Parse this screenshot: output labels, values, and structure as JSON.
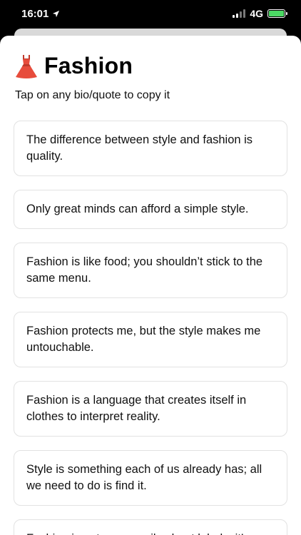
{
  "status_bar": {
    "time": "16:01",
    "network": "4G",
    "battery_color": "#4cd964"
  },
  "header": {
    "icon": "dress-icon",
    "title": "Fashion",
    "subtitle": "Tap on any bio/quote to copy it"
  },
  "quotes": [
    "The difference between style and fashion is quality.",
    "Only great minds can afford a simple style.",
    "Fashion is like food; you shouldn’t stick to the same menu.",
    "Fashion protects me, but the style makes me untouchable.",
    "Fashion is a language that creates itself in clothes to interpret reality.",
    "Style is something each of us already has; all we need to do is find it.",
    "Fashion is not necessarily about labels; it’s"
  ]
}
